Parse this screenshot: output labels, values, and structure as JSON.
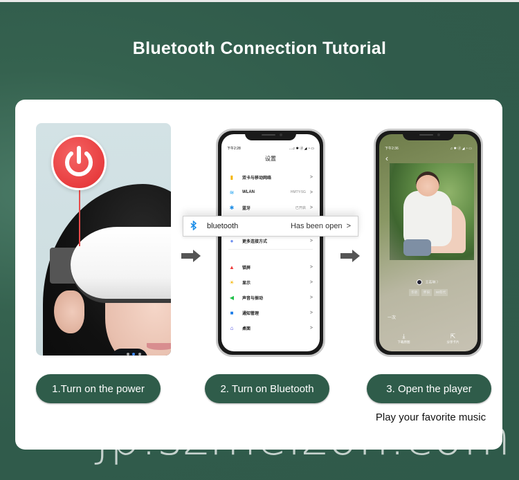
{
  "page": {
    "title": "Bluetooth Connection Tutorial",
    "watermark": "jp.szmeizon.com",
    "colors": {
      "background_green": "#305b4b",
      "pill_green": "#2f5c4a",
      "power_red": "#e83d3f",
      "bluetooth_blue": "#1a8de8"
    }
  },
  "steps": [
    {
      "label": "1.Turn on the power",
      "icon": "power-icon"
    },
    {
      "label": "2. Turn on Bluetooth",
      "icon": "bluetooth-icon"
    },
    {
      "label": "3. Open the player",
      "caption": "Play your favorite music"
    }
  ],
  "settings_phone": {
    "status_time": "下午2:28",
    "status_icons": "…♫ ✱ ⓓ ◢ ◔ ▭",
    "title": "设置",
    "rows": [
      {
        "icon": "sim-card-icon",
        "glyph": "▮",
        "color": "#f5b400",
        "label": "双卡与移动网络",
        "value": "",
        "chevron": ">"
      },
      {
        "icon": "wifi-icon",
        "glyph": "≋",
        "color": "#1aa0f0",
        "label": "WLAN",
        "value": "HMTY-5G",
        "chevron": ">"
      },
      {
        "icon": "bluetooth-icon",
        "glyph": "✱",
        "color": "#1a8de8",
        "label": "蓝牙",
        "value": "已开启",
        "chevron": ">"
      },
      {
        "icon": "more-connections-icon",
        "glyph": "●",
        "color": "#6d8ef0",
        "label": "更多连接方式",
        "value": "",
        "chevron": ">"
      },
      {
        "icon": "lock-screen-icon",
        "glyph": "▲",
        "color": "#ee3b3b",
        "label": "锁屏",
        "value": "",
        "chevron": ">"
      },
      {
        "icon": "display-icon",
        "glyph": "☀",
        "color": "#f5b400",
        "label": "显示",
        "value": "",
        "chevron": ">"
      },
      {
        "icon": "sound-icon",
        "glyph": "◀",
        "color": "#21c04a",
        "label": "声音与振动",
        "value": "",
        "chevron": ">"
      },
      {
        "icon": "notification-icon",
        "glyph": "■",
        "color": "#1a7be8",
        "label": "通知管理",
        "value": "",
        "chevron": ">"
      },
      {
        "icon": "home-screen-icon",
        "glyph": "⌂",
        "color": "#3a3adc",
        "label": "桌面",
        "value": "",
        "chevron": ">"
      }
    ]
  },
  "bluetooth_popup": {
    "label": "bluetooth",
    "status": "Has been open",
    "chevron": ">"
  },
  "player_phone": {
    "status_time": "下午2:36",
    "status_icons": "♫ ✱ ⓓ ◢ ◔ ▭",
    "back": "‹",
    "artist": "王若琳 〉",
    "tags": [
      "华语",
      "怀旧",
      "90年代"
    ],
    "lyric": "一次",
    "actions": [
      {
        "icon": "download-icon",
        "glyph": "⤓",
        "label": "下载原图"
      },
      {
        "icon": "share-icon",
        "glyph": "⇱",
        "label": "分享卡片"
      }
    ]
  }
}
